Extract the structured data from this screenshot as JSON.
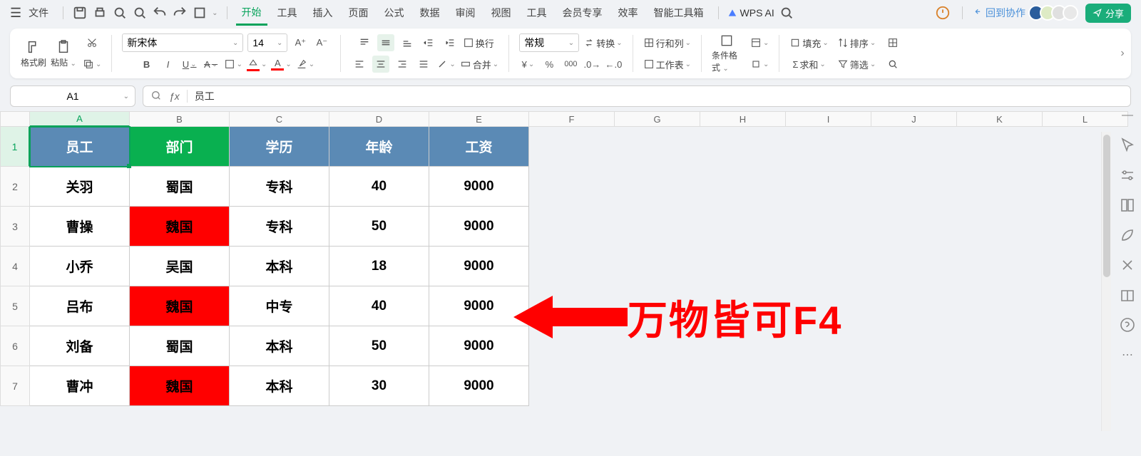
{
  "menu": {
    "file": "文件",
    "tabs": [
      "开始",
      "工具",
      "插入",
      "页面",
      "公式",
      "数据",
      "审阅",
      "视图",
      "工具",
      "会员专享",
      "效率",
      "智能工具箱"
    ],
    "ai": "WPS AI",
    "backCollab": "回到协作",
    "share": "分享"
  },
  "ribbon": {
    "formatPainter": "格式刷",
    "paste": "粘贴",
    "fontName": "新宋体",
    "fontSize": "14",
    "wrap": "换行",
    "merge": "合并",
    "numFormat": "常规",
    "convert": "转换",
    "rowsCols": "行和列",
    "worksheet": "工作表",
    "condFormat": "条件格式",
    "fill": "填充",
    "sort": "排序",
    "sum": "求和",
    "filter": "筛选"
  },
  "namebox": "A1",
  "formula": "员工",
  "columns": [
    "A",
    "B",
    "C",
    "D",
    "E",
    "F",
    "G",
    "H",
    "I",
    "J",
    "K",
    "L"
  ],
  "rowNums": [
    "1",
    "2",
    "3",
    "4",
    "5",
    "6",
    "7"
  ],
  "table": {
    "headers": [
      "员工",
      "部门",
      "学历",
      "年龄",
      "工资"
    ],
    "rows": [
      [
        "关羽",
        "蜀国",
        "专科",
        "40",
        "9000"
      ],
      [
        "曹操",
        "魏国",
        "专科",
        "50",
        "9000"
      ],
      [
        "小乔",
        "吴国",
        "本科",
        "18",
        "9000"
      ],
      [
        "吕布",
        "魏国",
        "中专",
        "40",
        "9000"
      ],
      [
        "刘备",
        "蜀国",
        "本科",
        "50",
        "9000"
      ],
      [
        "曹冲",
        "魏国",
        "本科",
        "30",
        "9000"
      ]
    ]
  },
  "annotation": "万物皆可F4",
  "chart_data": {
    "type": "table",
    "columns": [
      "员工",
      "部门",
      "学历",
      "年龄",
      "工资"
    ],
    "rows": [
      {
        "员工": "关羽",
        "部门": "蜀国",
        "学历": "专科",
        "年龄": 40,
        "工资": 9000
      },
      {
        "员工": "曹操",
        "部门": "魏国",
        "学历": "专科",
        "年龄": 50,
        "工资": 9000
      },
      {
        "员工": "小乔",
        "部门": "吴国",
        "学历": "本科",
        "年龄": 18,
        "工资": 9000
      },
      {
        "员工": "吕布",
        "部门": "魏国",
        "学历": "中专",
        "年龄": 40,
        "工资": 9000
      },
      {
        "员工": "刘备",
        "部门": "蜀国",
        "学历": "本科",
        "年龄": 50,
        "工资": 9000
      },
      {
        "员工": "曹冲",
        "部门": "魏国",
        "学历": "本科",
        "年龄": 30,
        "工资": 9000
      }
    ]
  }
}
